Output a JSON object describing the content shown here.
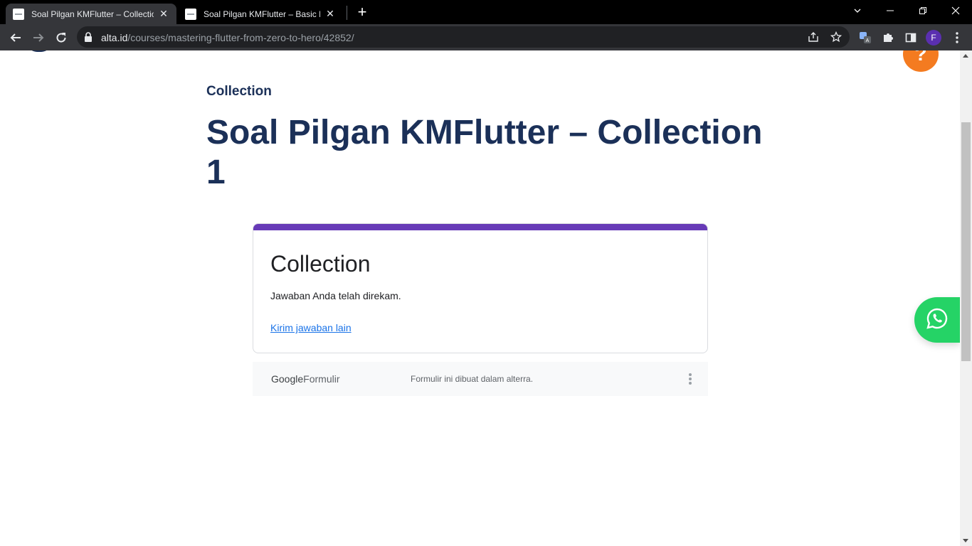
{
  "browser": {
    "tabs": [
      {
        "title": "Soal Pilgan KMFlutter – Collection 1",
        "active": true
      },
      {
        "title": "Soal Pilgan KMFlutter – Basic Dart",
        "active": false
      }
    ],
    "url": {
      "domain": "alta.id",
      "path": "/courses/mastering-flutter-from-zero-to-hero/42852/"
    },
    "profile_initial": "F"
  },
  "page": {
    "section_label": "Collection",
    "title": "Soal Pilgan KMFlutter – Collection 1",
    "help_icon_glyph": "?"
  },
  "form": {
    "accent_color": "#673ab7",
    "title": "Collection",
    "message": "Jawaban Anda telah direkam.",
    "link": "Kirim jawaban lain"
  },
  "form_footer": {
    "brand_google": "Google",
    "brand_formulir": "Formulir",
    "note": "Formulir ini dibuat dalam alterra."
  },
  "colors": {
    "brand_navy": "#1b3058",
    "help_orange": "#f47b20",
    "whatsapp_green": "#25d366"
  }
}
